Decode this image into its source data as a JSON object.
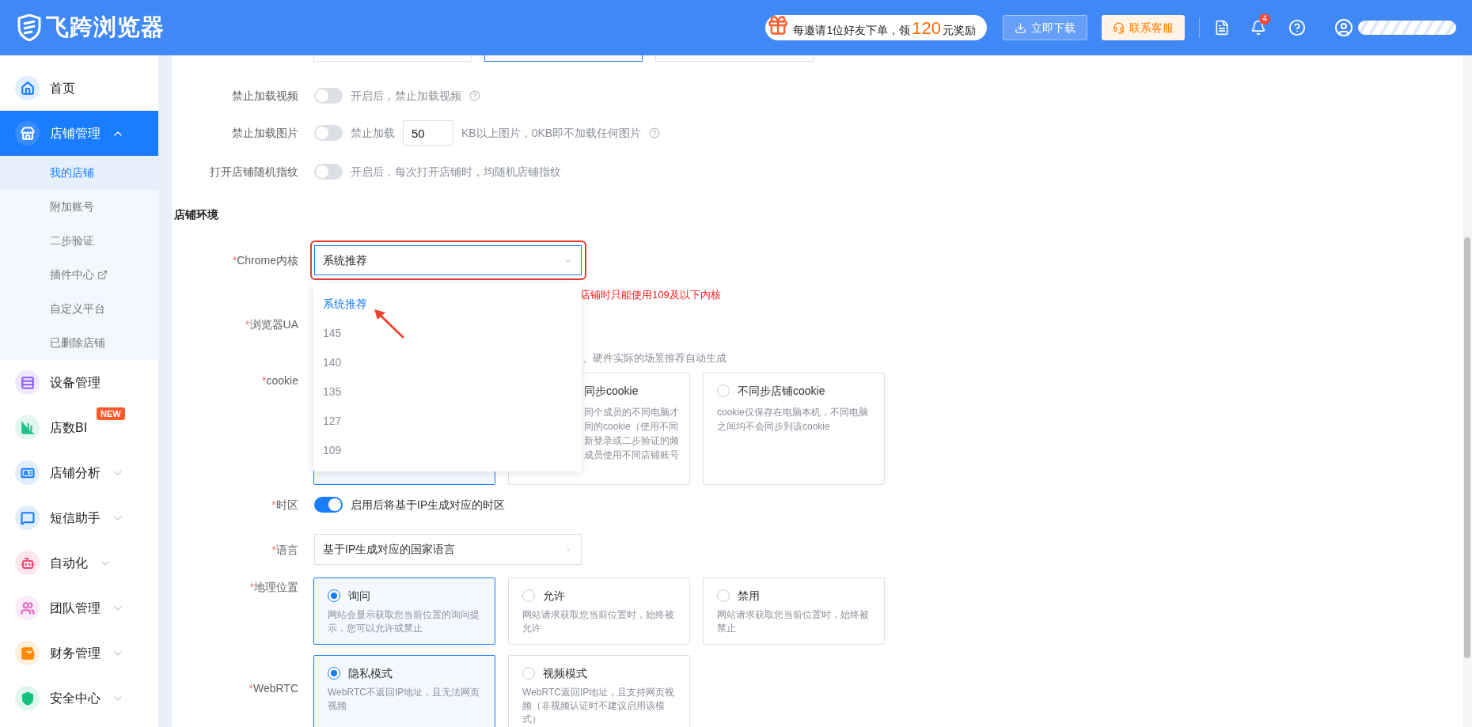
{
  "topbar": {
    "logo": "飞跨浏览器",
    "promo": {
      "prefix": "每邀请1位好友下单，领",
      "amount": "120",
      "suffix": "元奖励"
    },
    "download": "立即下载",
    "support": "联系客服",
    "notifications": "4"
  },
  "sidebar": {
    "items": [
      {
        "label": "首页",
        "kind": "home",
        "color": "#1a7cff",
        "selected": false
      },
      {
        "label": "店铺管理",
        "kind": "store",
        "color": "#ffffff",
        "selected": true,
        "expanded": true,
        "children": [
          {
            "label": "我的店铺",
            "selected": true,
            "external": false
          },
          {
            "label": "附加账号",
            "selected": false,
            "external": false
          },
          {
            "label": "二步验证",
            "selected": false,
            "external": false
          },
          {
            "label": "插件中心",
            "selected": false,
            "external": true
          },
          {
            "label": "自定义平台",
            "selected": false,
            "external": false
          },
          {
            "label": "已删除店铺",
            "selected": false,
            "external": false
          }
        ]
      },
      {
        "label": "设备管理",
        "kind": "device",
        "color": "#8b5cf6",
        "selected": false
      },
      {
        "label": "店数BI",
        "kind": "chart",
        "color": "#1cc48a",
        "selected": false,
        "badge": "NEW"
      },
      {
        "label": "店铺分析",
        "kind": "analysis",
        "color": "#1a7cff",
        "selected": false,
        "expanded": false
      },
      {
        "label": "短信助手",
        "kind": "sms",
        "color": "#1a7cff",
        "selected": false,
        "expanded": false
      },
      {
        "label": "自动化",
        "kind": "robot",
        "color": "#f0497a",
        "selected": false,
        "expanded": false
      },
      {
        "label": "团队管理",
        "kind": "team",
        "color": "#e062c4",
        "selected": false,
        "expanded": false
      },
      {
        "label": "财务管理",
        "kind": "wallet",
        "color": "#ff8a00",
        "selected": false,
        "expanded": false
      },
      {
        "label": "安全中心",
        "kind": "shield",
        "color": "#12c27a",
        "selected": false,
        "expanded": false
      }
    ]
  },
  "top_cards": [
    {
      "selected": false
    },
    {
      "selected": true
    },
    {
      "selected": false
    }
  ],
  "settings": [
    {
      "label": "禁止加载视频",
      "on": false,
      "text": "开启后，禁止加载视频",
      "help": true
    },
    {
      "label": "禁止加载图片",
      "on": false,
      "text": "禁止加载",
      "value": "50",
      "suffix": "KB以上图片，0KB即不加载任何图片",
      "help": true
    },
    {
      "label": "打开店铺随机指纹",
      "on": false,
      "text": "开启后，每次打开店铺时，均随机店铺指纹"
    }
  ],
  "section": "店铺环境",
  "chrome": {
    "label": "Chrome内核",
    "mark": "*",
    "value": "系统推荐",
    "highlighted": true,
    "open": true,
    "warning": "店铺时只能使用109及以下内核",
    "options": [
      {
        "label": "系统推荐",
        "selected": true
      },
      {
        "label": "145",
        "selected": false
      },
      {
        "label": "140",
        "selected": false
      },
      {
        "label": "135",
        "selected": false
      },
      {
        "label": "127",
        "selected": false
      },
      {
        "label": "109",
        "selected": false
      }
    ]
  },
  "ua": {
    "label": "浏览器UA",
    "mark": "*",
    "hint": "、硬件实际的场景推荐自动生成"
  },
  "cookie": {
    "label": "cookie",
    "mark": "*",
    "options": [
      {
        "selected": true
      },
      {
        "selected": false,
        "title": "同步cookie",
        "desc_lines": [
          "同个成员的不同电脑才",
          "同的cookie（使用不同",
          "新登录或二步验证的频",
          "成员使用不同店铺账号"
        ]
      },
      {
        "selected": false,
        "title": "不同步店铺cookie",
        "desc_lines": [
          "cookie仅保存在电脑本机，不同电脑",
          "之间均不会同步到该cookie"
        ]
      }
    ]
  },
  "timezone": {
    "label": "时区",
    "mark": "*",
    "on": true,
    "text": "启用后将基于IP生成对应的时区"
  },
  "language": {
    "label": "语言",
    "mark": "*",
    "value": "基于IP生成对应的国家语言"
  },
  "geolocation": {
    "label": "地理位置",
    "mark": "*",
    "options": [
      {
        "selected": true,
        "title": "询问",
        "desc_lines": [
          "网站会显示获取您当前位置的询问提",
          "示，您可以允许或禁止"
        ]
      },
      {
        "selected": false,
        "title": "允许",
        "desc_lines": [
          "网站请求获取您当前位置时，始终被",
          "允许"
        ]
      },
      {
        "selected": false,
        "title": "禁用",
        "desc_lines": [
          "网站请求获取您当前位置时，始终被",
          "禁止"
        ]
      }
    ]
  },
  "webrtc": {
    "label": "WebRTC",
    "mark": "*",
    "options": [
      {
        "selected": true,
        "title": "隐私模式",
        "desc_lines": [
          "WebRTC不返回IP地址，且无法网页",
          "视频"
        ]
      },
      {
        "selected": false,
        "title": "视频模式",
        "desc_lines": [
          "WebRTC返回IP地址，且支持网页视",
          "频（非视频认证时不建议启用该模",
          "式）"
        ]
      }
    ]
  }
}
